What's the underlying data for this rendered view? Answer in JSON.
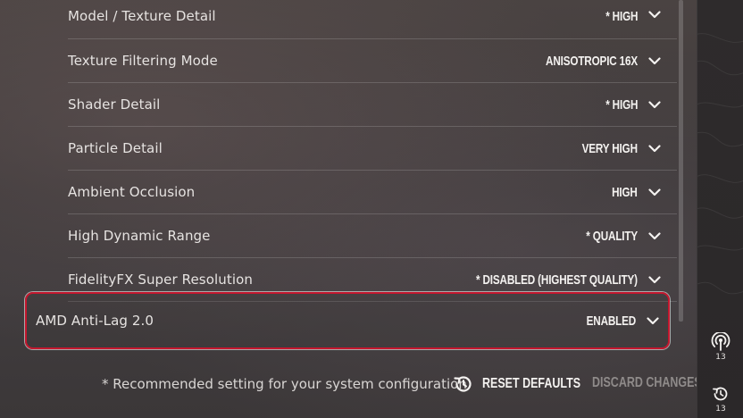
{
  "settings": [
    {
      "label": "Model / Texture Detail",
      "value": "* HIGH"
    },
    {
      "label": "Texture Filtering Mode",
      "value": "ANISOTROPIC 16X"
    },
    {
      "label": "Shader Detail",
      "value": "* HIGH"
    },
    {
      "label": "Particle Detail",
      "value": "VERY HIGH"
    },
    {
      "label": "Ambient Occlusion",
      "value": "HIGH"
    },
    {
      "label": "High Dynamic Range",
      "value": "* QUALITY"
    },
    {
      "label": "FidelityFX Super Resolution",
      "value": "* DISABLED (HIGHEST QUALITY)"
    }
  ],
  "highlighted_setting": {
    "label": "AMD Anti-Lag 2.0",
    "value": "ENABLED"
  },
  "footer": {
    "footnote": "* Recommended setting for your system configuration",
    "reset_label": "RESET DEFAULTS",
    "discard_label": "DISCARD CHANGES"
  },
  "right_rail": [
    {
      "icon": "broadcast-icon",
      "count": "13"
    },
    {
      "icon": "history-icon",
      "count": "13"
    }
  ],
  "colors": {
    "highlight_border": "#c4172e",
    "text_primary": "#f4f2f0",
    "text_dim": "#8f8b8a"
  }
}
